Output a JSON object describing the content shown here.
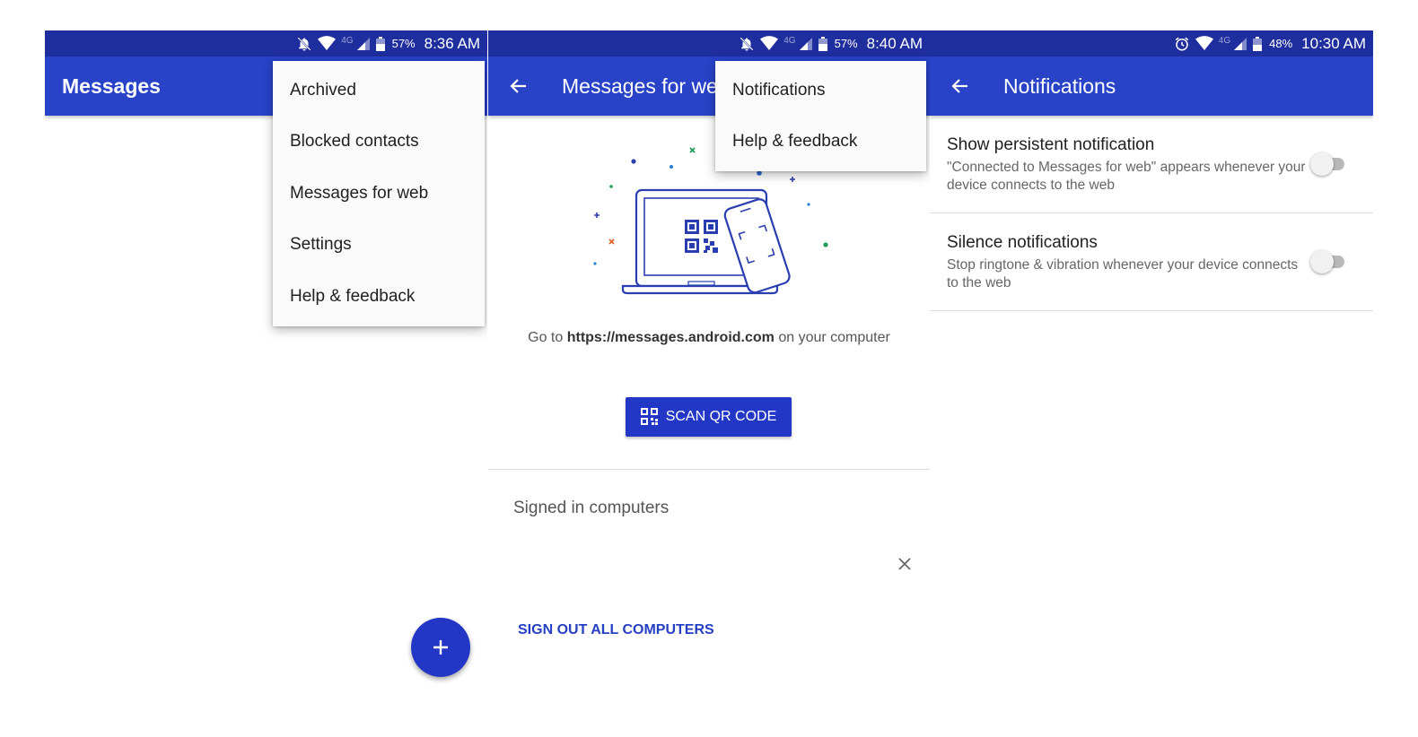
{
  "screens": [
    {
      "status": {
        "battery": "57%",
        "time": "8:36 AM",
        "network": "4G"
      },
      "appbar_title": "Messages",
      "menu": [
        "Archived",
        "Blocked contacts",
        "Messages for web",
        "Settings",
        "Help & feedback"
      ]
    },
    {
      "status": {
        "battery": "57%",
        "time": "8:40 AM",
        "network": "4G"
      },
      "appbar_title": "Messages for web",
      "menu": [
        "Notifications",
        "Help & feedback"
      ],
      "go_to_prefix": "Go to ",
      "go_to_url": "https://messages.android.com",
      "go_to_suffix": " on your computer",
      "scan_button": "SCAN QR CODE",
      "signed_in_header": "Signed in computers",
      "sign_out_all": "SIGN OUT ALL COMPUTERS"
    },
    {
      "status": {
        "battery": "48%",
        "time": "10:30 AM",
        "network": "4G"
      },
      "appbar_title": "Notifications",
      "settings": [
        {
          "title": "Show persistent notification",
          "description": "\"Connected to Messages for web\" appears whenever your device connects to the web",
          "enabled": false
        },
        {
          "title": "Silence notifications",
          "description": "Stop ringtone & vibration whenever your device connects to the web",
          "enabled": false
        }
      ]
    }
  ],
  "colors": {
    "status_bar": "#1e2e9e",
    "app_bar": "#2842c8",
    "accent": "#2237c5",
    "link": "#2540c3"
  },
  "icons": [
    "mute-icon",
    "wifi-icon",
    "signal-icon",
    "battery-icon",
    "alarm-icon",
    "back-arrow-icon",
    "plus-icon",
    "qr-code-icon",
    "close-icon"
  ]
}
